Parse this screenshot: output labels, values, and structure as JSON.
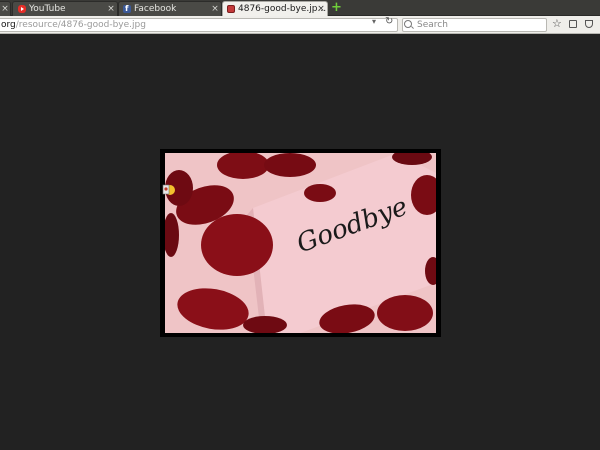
{
  "tabs": [
    {
      "label": "YouTube",
      "favicon": "youtube-icon",
      "close": "×",
      "active": false
    },
    {
      "label": "Facebook",
      "favicon": "facebook-icon",
      "close": "×",
      "active": false
    },
    {
      "label": "4876-good-bye.jp...",
      "favicon": "image-file-icon",
      "close": "×",
      "active": true
    }
  ],
  "tab_strip": {
    "first_close": "×",
    "new_tab": "+"
  },
  "navbar": {
    "url_host": "org",
    "url_path": "/resource/4876-good-bye.jpg",
    "search_placeholder": "Search",
    "reload_glyph": "↻",
    "dropdown_glyph": "▾",
    "bookmark_glyph": "☆"
  },
  "image": {
    "card_text": "Goodbye",
    "card_color": "#f4c9cf",
    "petal_color": "#7d0f17",
    "background_color": "#f0c7c8"
  },
  "colors": {
    "page_background": "#222222",
    "tabbar": "#3a3a37",
    "active_tab": "#f1f0ec"
  }
}
